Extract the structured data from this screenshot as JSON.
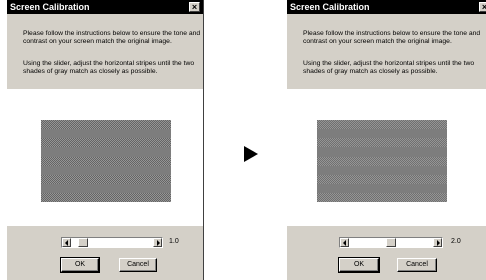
{
  "before": {
    "title": "Screen Calibration",
    "instructions_1": "Please follow the instructions below to ensure the tone and contrast on your screen match the original image.",
    "instructions_2": "Using the slider, adjust the horizontal stripes until the two shades of gray match as closely as possible.",
    "slider_value": "1.0",
    "slider_position": 0.1,
    "ok_label": "OK",
    "cancel_label": "Cancel"
  },
  "after": {
    "title": "Screen Calibration",
    "instructions_1": "Please follow the instructions below to ensure the tone and contrast on your screen match the original image.",
    "instructions_2": "Using the slider, adjust the horizontal stripes until the two shades of gray match as closely as possible.",
    "slider_value": "2.0",
    "slider_position": 0.5,
    "ok_label": "OK",
    "cancel_label": "Cancel"
  },
  "colors": {
    "titlebar": "#000000",
    "dialog_face": "#d4d0c8",
    "light_band": "#959595",
    "dark_band": "#656565"
  },
  "icons": {
    "transition": "right-triangle-arrow",
    "close": "close-x",
    "slider_left": "left-arrow",
    "slider_right": "right-arrow"
  }
}
